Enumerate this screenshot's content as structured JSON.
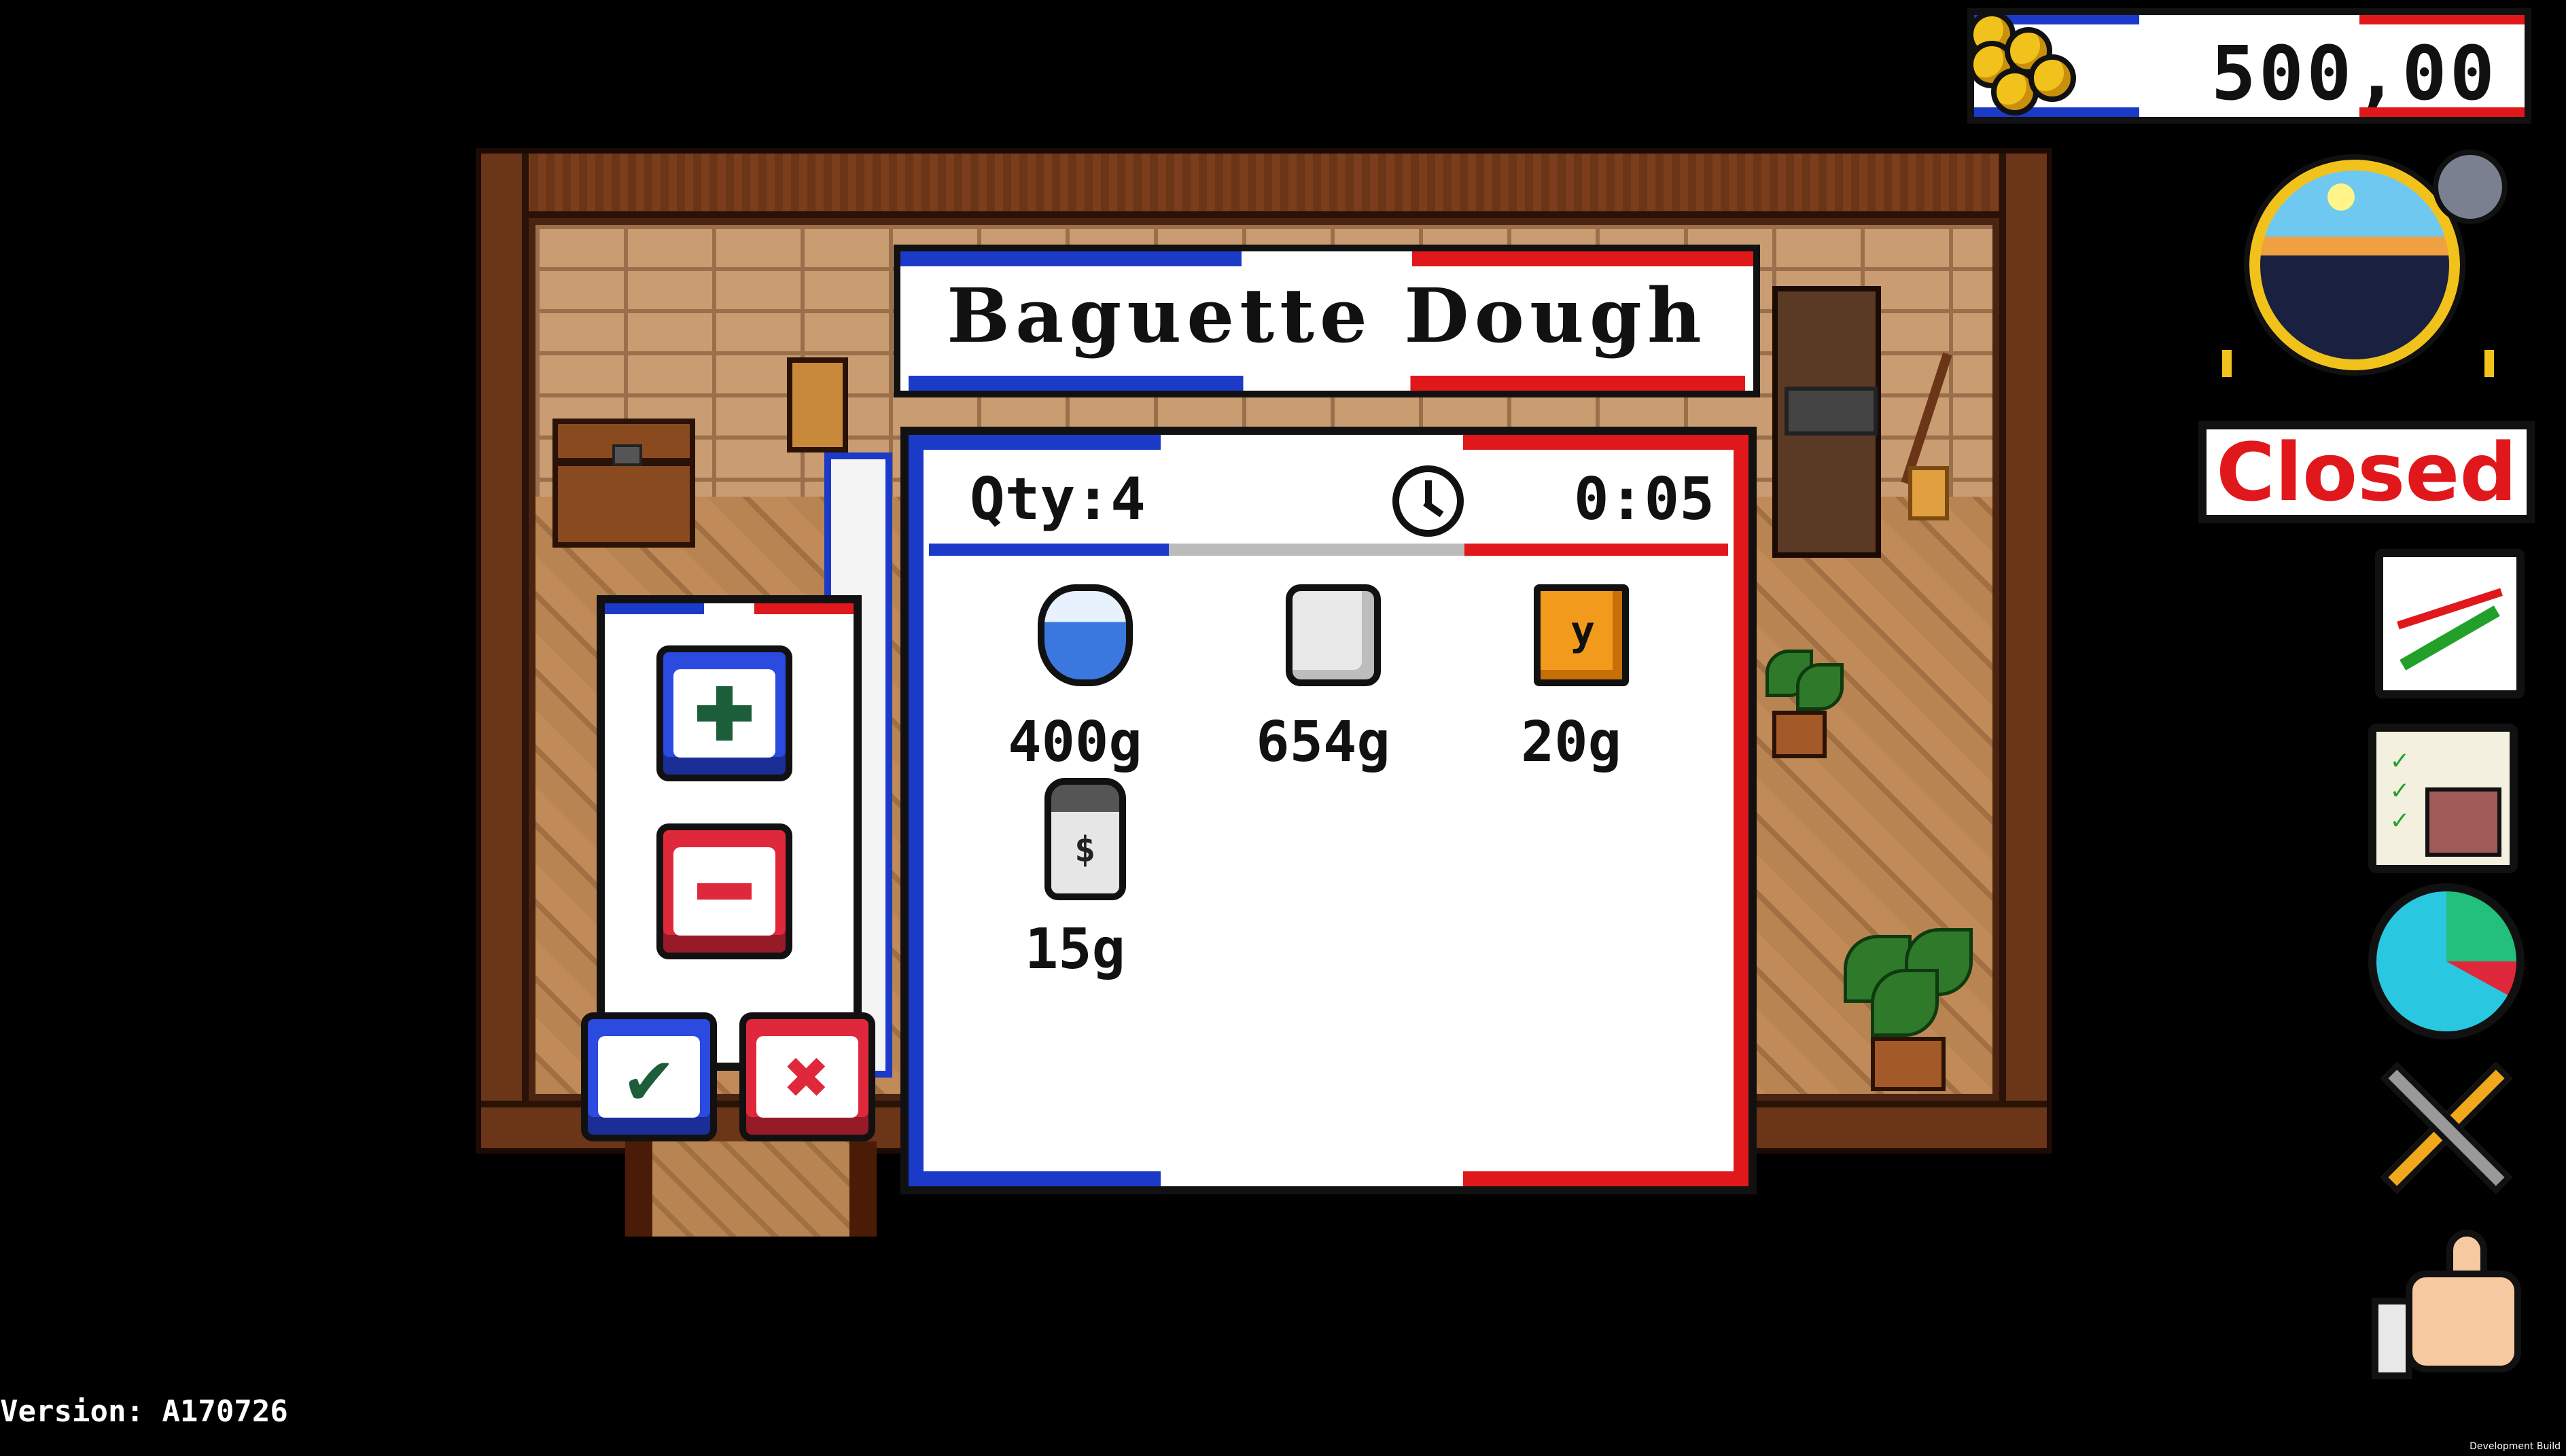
{
  "hud": {
    "money": "500,00",
    "shop_status": "Closed"
  },
  "recipe": {
    "title": "Baguette Dough",
    "qty_label": "Qty:4",
    "time": "0:05",
    "ingredients": [
      {
        "icon": "water-icon",
        "amount": "400g"
      },
      {
        "icon": "flour-icon",
        "amount": "654g"
      },
      {
        "icon": "yeast-icon",
        "amount": "20g"
      },
      {
        "icon": "salt-icon",
        "amount": "15g"
      }
    ]
  },
  "footer": {
    "version": "Version: A170726",
    "build": "Development Build"
  },
  "colors": {
    "blue": "#1c3ac8",
    "red": "#e0181c",
    "gold": "#f2c21c"
  }
}
